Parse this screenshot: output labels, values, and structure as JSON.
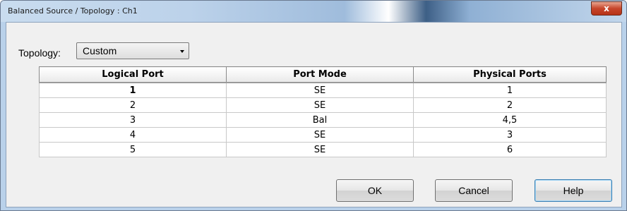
{
  "window": {
    "title": "Balanced Source / Topology : Ch1",
    "close_label": "x"
  },
  "topology": {
    "label": "Topology:",
    "selected": "Custom"
  },
  "table": {
    "headers": [
      "Logical Port",
      "Port Mode",
      "Physical Ports"
    ],
    "rows": [
      [
        "1",
        "SE",
        "1"
      ],
      [
        "2",
        "SE",
        "2"
      ],
      [
        "3",
        "Bal",
        "4,5"
      ],
      [
        "4",
        "SE",
        "3"
      ],
      [
        "5",
        "SE",
        "6"
      ]
    ]
  },
  "buttons": {
    "ok": "OK",
    "cancel": "Cancel",
    "help": "Help"
  }
}
